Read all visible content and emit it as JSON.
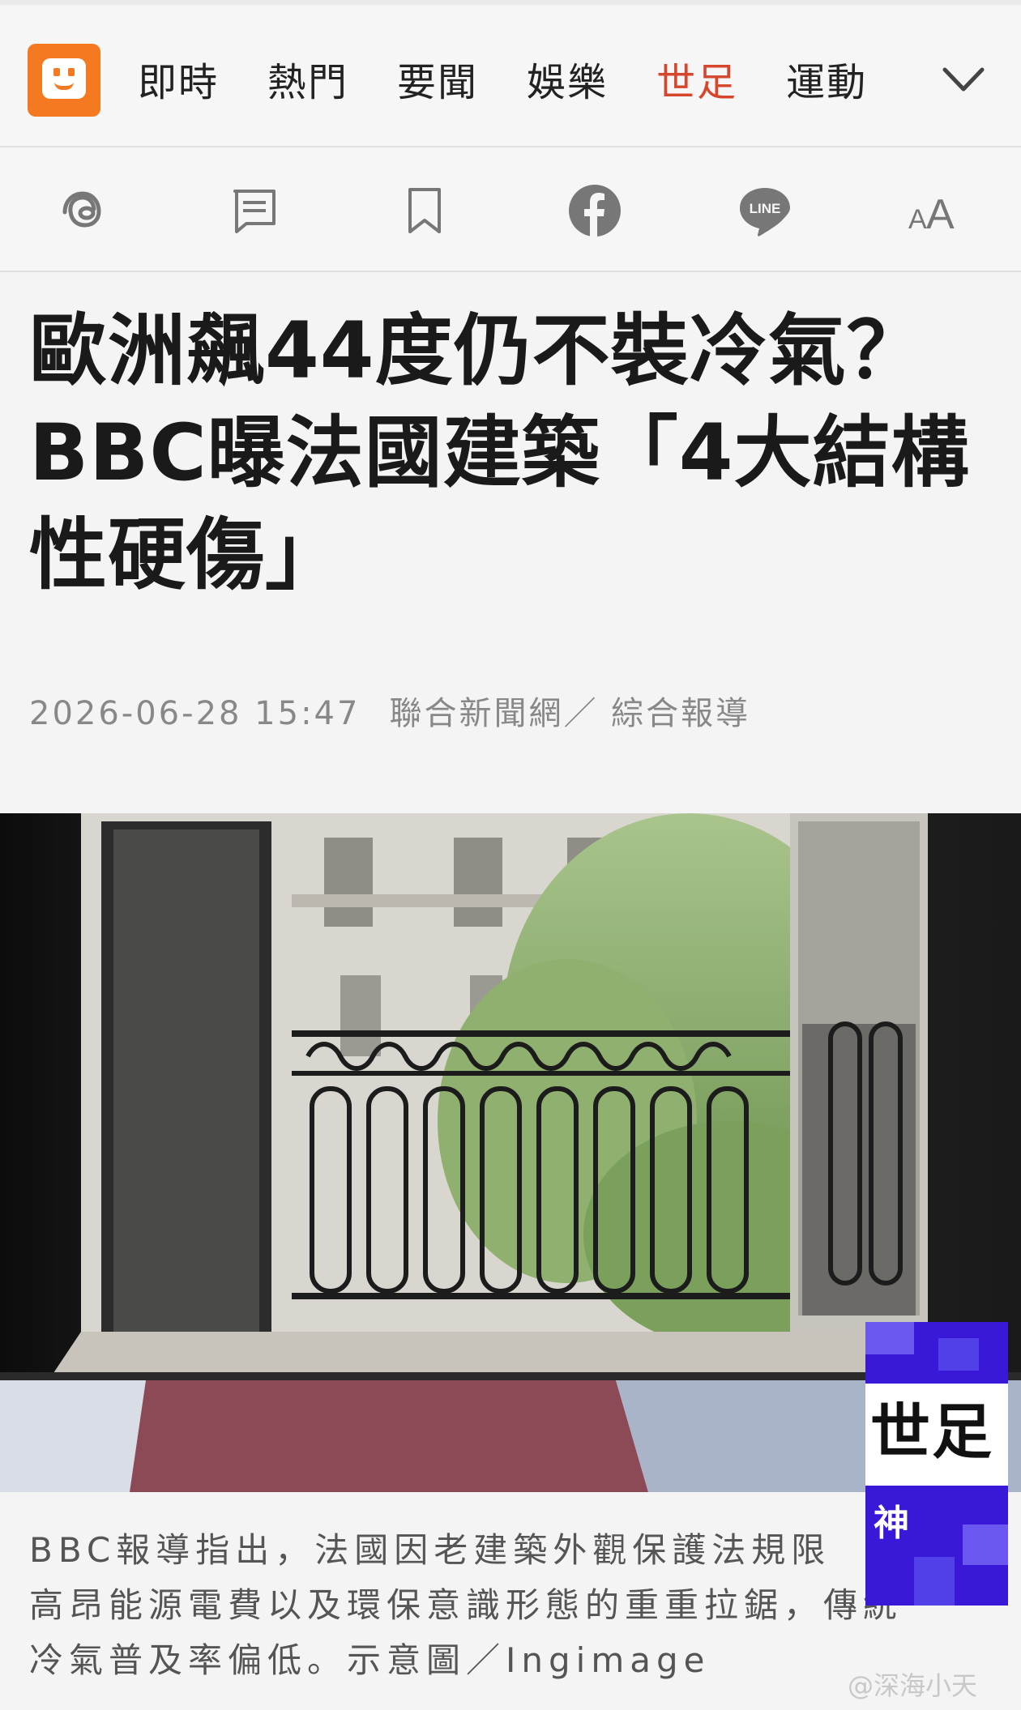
{
  "nav": {
    "logo_icon": "udn-face-logo",
    "tabs": [
      {
        "label": "即時"
      },
      {
        "label": "熱門"
      },
      {
        "label": "要聞"
      },
      {
        "label": "娛樂"
      },
      {
        "label": "世足",
        "active": true
      },
      {
        "label": "運動"
      }
    ],
    "accent_color": "#d5462d",
    "logo_color": "#f47920"
  },
  "toolbar": {
    "icons": [
      "threads-icon",
      "comment-icon",
      "bookmark-icon",
      "facebook-icon",
      "line-icon",
      "font-size-icon"
    ],
    "line_label": "LINE",
    "font_label": "AA"
  },
  "article": {
    "title_lines": [
      "歐洲飆44度仍不裝冷氣？",
      "BBC曝法國建築「4大結構",
      "性硬傷」"
    ],
    "timestamp": "2026-06-28 15:47",
    "source": "聯合新聞網／ 綜合報導",
    "caption_lines": [
      "BBC報導指出，法國因老建築外觀保護法規限",
      "高昂能源電費以及環保意識形態的重重拉鋸，傳統",
      "冷氣普及率偏低。示意圖／Ingimage"
    ]
  },
  "badge": {
    "title": "世足",
    "sub": "神",
    "color": "#3a18d8"
  },
  "watermark": "@深海小天"
}
